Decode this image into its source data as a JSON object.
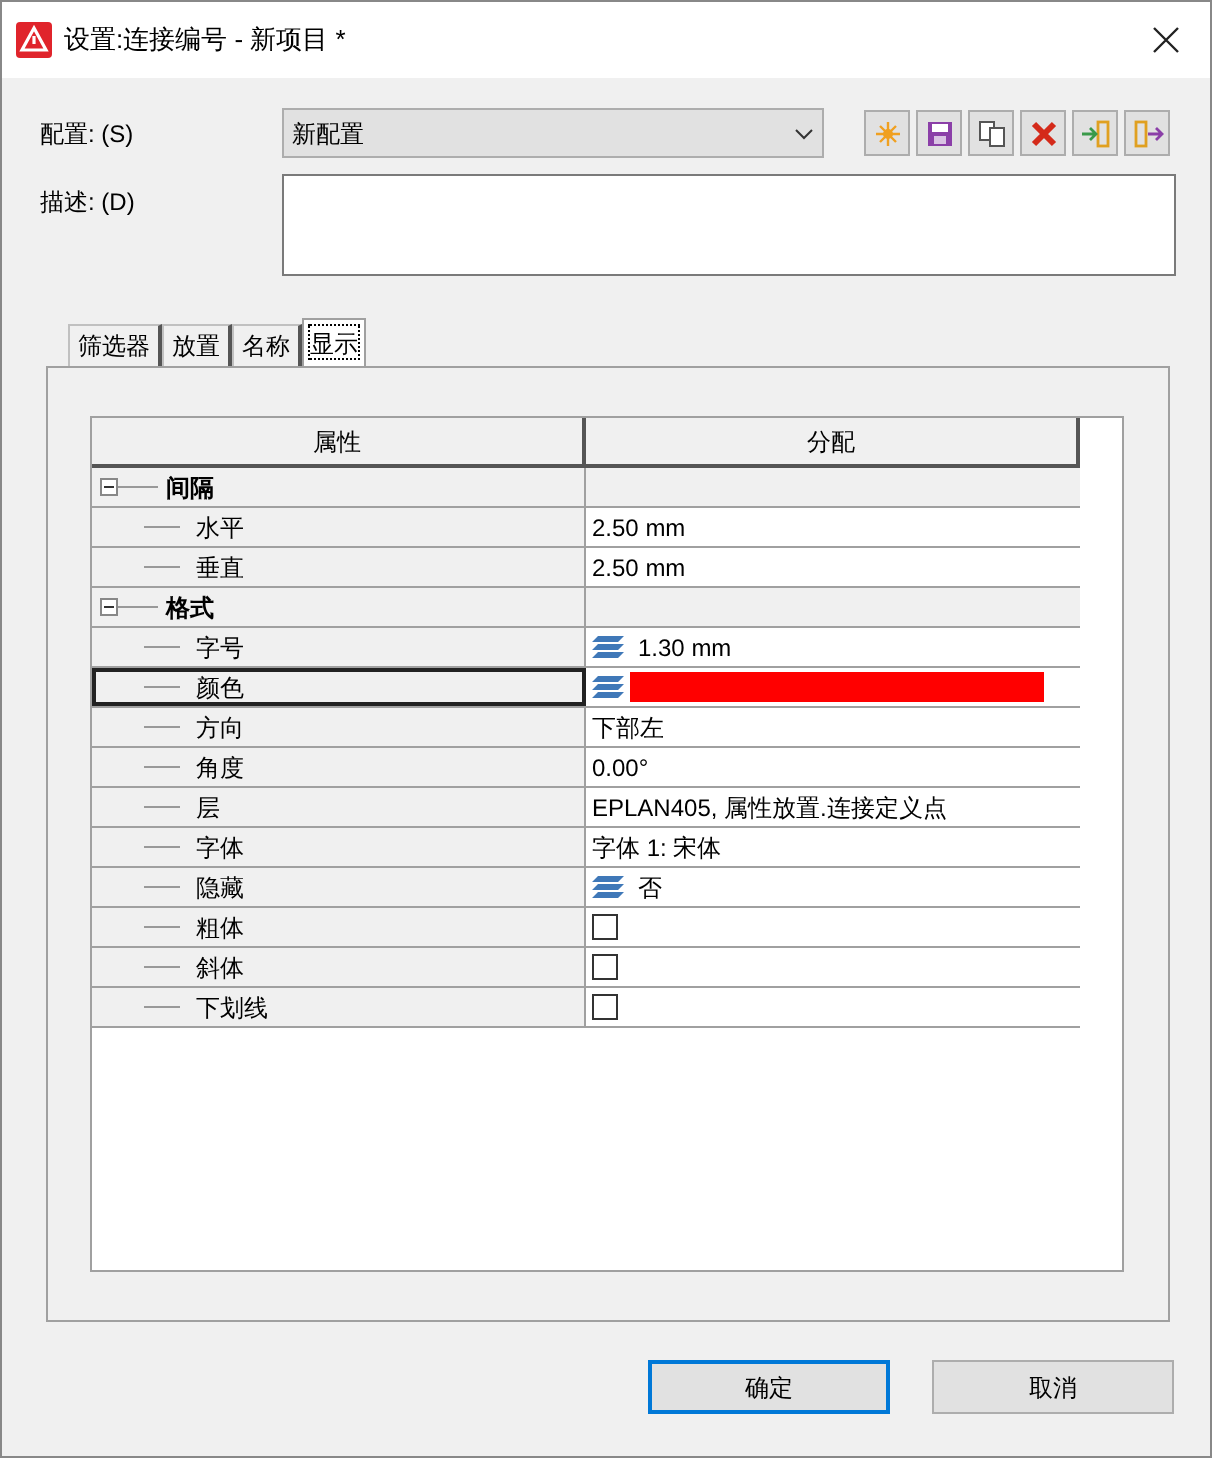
{
  "window": {
    "title": "设置:连接编号 - 新项目 *"
  },
  "config": {
    "label": "配置: (S)",
    "value": "新配置"
  },
  "toolbar": [
    {
      "kind": "new"
    },
    {
      "kind": "save"
    },
    {
      "kind": "copy"
    },
    {
      "kind": "delete"
    },
    {
      "kind": "import"
    },
    {
      "kind": "export"
    }
  ],
  "description": {
    "label": "描述: (D)"
  },
  "tabs": [
    {
      "label": "筛选器",
      "selected": false
    },
    {
      "label": "放置",
      "selected": false
    },
    {
      "label": "名称",
      "selected": false
    },
    {
      "label": "显示",
      "selected": true
    }
  ],
  "table": {
    "columns": [
      "属性",
      "分配"
    ],
    "groups": [
      {
        "label": "间隔",
        "expanded": true,
        "children": [
          {
            "label": "水平",
            "kind": "text",
            "value": "2.50 mm",
            "selected": false
          },
          {
            "label": "垂直",
            "kind": "text",
            "value": "2.50 mm",
            "selected": false
          }
        ]
      },
      {
        "label": "格式",
        "expanded": true,
        "children": [
          {
            "label": "字号",
            "kind": "layered",
            "value": "1.30 mm",
            "selected": false
          },
          {
            "label": "颜色",
            "kind": "color",
            "color": "#ff0000",
            "selected": true
          },
          {
            "label": "方向",
            "kind": "text",
            "value": "下部左",
            "selected": false
          },
          {
            "label": "角度",
            "kind": "text",
            "value": "0.00°",
            "selected": false
          },
          {
            "label": "层",
            "kind": "text",
            "value": "EPLAN405, 属性放置.连接定义点",
            "selected": false
          },
          {
            "label": "字体",
            "kind": "text",
            "value": "字体 1: 宋体",
            "selected": false
          },
          {
            "label": "隐藏",
            "kind": "layered",
            "value": "否",
            "selected": false
          },
          {
            "label": "粗体",
            "kind": "checkbox",
            "checked": false,
            "selected": false
          },
          {
            "label": "斜体",
            "kind": "checkbox",
            "checked": false,
            "selected": false
          },
          {
            "label": "下划线",
            "kind": "checkbox",
            "checked": false,
            "selected": false
          }
        ]
      }
    ]
  },
  "buttons": [
    {
      "label": "确定",
      "default": true
    },
    {
      "label": "取消",
      "default": false
    }
  ]
}
